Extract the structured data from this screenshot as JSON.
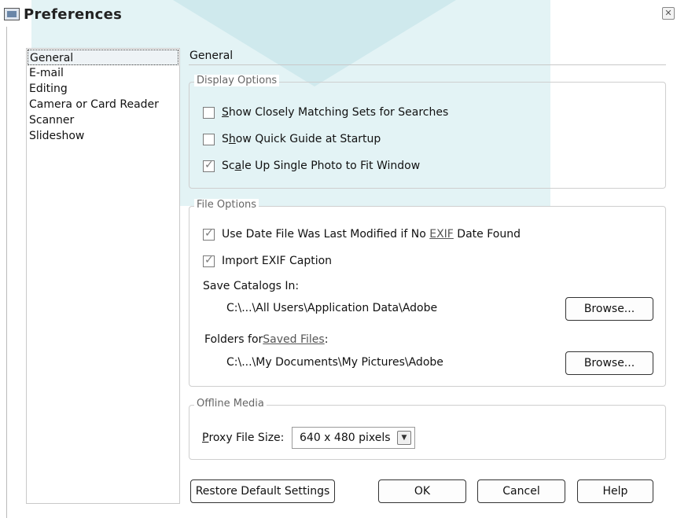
{
  "window": {
    "title": "Preferences",
    "close_glyph": "✕"
  },
  "sidebar": {
    "items": [
      {
        "label": "General",
        "selected": true
      },
      {
        "label": "E-mail"
      },
      {
        "label": "Editing"
      },
      {
        "label": "Camera or Card Reader"
      },
      {
        "label": "Scanner"
      },
      {
        "label": "Slideshow"
      }
    ]
  },
  "main": {
    "section_title": "General",
    "display_options": {
      "label": "Display Options",
      "show_matching_sets": {
        "access_key": "S",
        "rest": "how Closely Matching Sets for Searches",
        "checked": false
      },
      "show_quick_guide": {
        "before": "S",
        "access_key": "h",
        "rest": "ow Quick Guide at Startup",
        "checked": false
      },
      "scale_up": {
        "before": "Sc",
        "access_key": "a",
        "rest": "le Up Single Photo to Fit Window",
        "checked": true
      }
    },
    "file_options": {
      "label": "File Options",
      "use_date_modified": {
        "before": "Use Date File Was Last Modified if No ",
        "link": "EXIF",
        "after": " Date Found",
        "checked": true
      },
      "import_exif": {
        "label": "Import EXIF Caption",
        "checked": true
      },
      "save_catalogs_label": "Save Catalogs In:",
      "save_catalogs_path": "C:\\...\\All Users\\Application Data\\Adobe",
      "folders_label_before": "Folders for ",
      "folders_label_link": "Saved Files",
      "folders_label_after": ":",
      "folders_path": "C:\\...\\My Documents\\My Pictures\\Adobe",
      "browse_label": "Browse..."
    },
    "offline_media": {
      "label": "Offline Media",
      "proxy_access_key": "P",
      "proxy_rest": "roxy File Size:",
      "proxy_value": "640 x 480 pixels"
    }
  },
  "footer": {
    "restore_label": "Restore Default Settings",
    "ok_label": "OK",
    "cancel_label": "Cancel",
    "help_label": "Help"
  },
  "icons": {
    "app": "preferences-app-icon",
    "close": "close-icon",
    "dropdown": "chevron-down-icon",
    "checkmark": "checkmark-icon"
  },
  "colors": {
    "watermark": "#e3f3f5",
    "border": "#cfcfcf",
    "group_label": "#666666"
  }
}
